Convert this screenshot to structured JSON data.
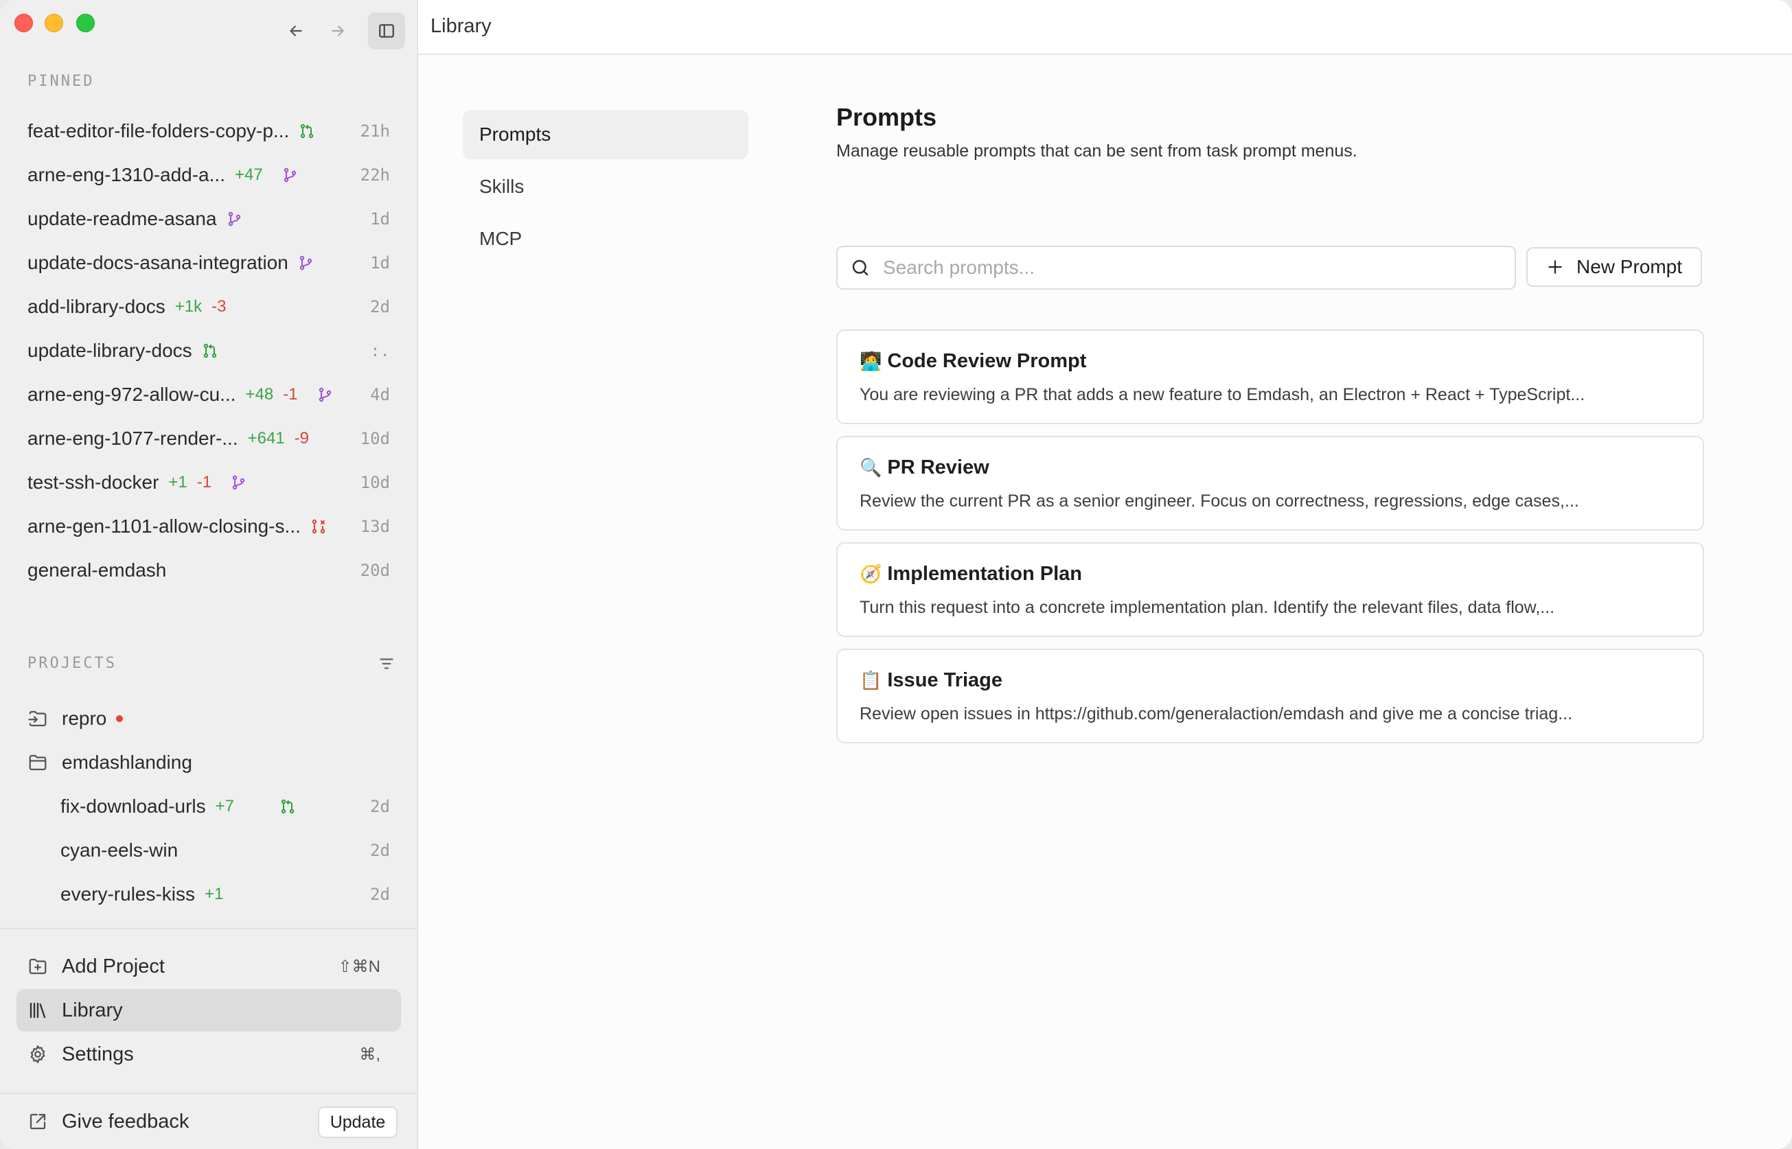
{
  "window": {
    "title": "Library"
  },
  "sidebar": {
    "pinned_label": "PINNED",
    "pinned": [
      {
        "name": "feat-editor-file-folders-copy-p...",
        "plus": "",
        "minus": "",
        "icon": "pr-open-icon",
        "age": "21h"
      },
      {
        "name": "arne-eng-1310-add-a...",
        "plus": "+47",
        "minus": "",
        "icon": "branch-icon",
        "age": "22h"
      },
      {
        "name": "update-readme-asana",
        "plus": "",
        "minus": "",
        "icon": "branch-icon",
        "age": "1d"
      },
      {
        "name": "update-docs-asana-integration",
        "plus": "",
        "minus": "",
        "icon": "branch-icon",
        "age": "1d"
      },
      {
        "name": "add-library-docs",
        "plus": "+1k",
        "minus": "-3",
        "icon": "",
        "age": "2d"
      },
      {
        "name": "update-library-docs",
        "plus": "",
        "minus": "",
        "icon": "pr-open-icon",
        "age": ":."
      },
      {
        "name": "arne-eng-972-allow-cu...",
        "plus": "+48",
        "minus": "-1",
        "icon": "branch-icon",
        "age": "4d"
      },
      {
        "name": "arne-eng-1077-render-...",
        "plus": "+641",
        "minus": "-9",
        "icon": "",
        "age": "10d"
      },
      {
        "name": "test-ssh-docker",
        "plus": "+1",
        "minus": "-1",
        "icon": "branch-icon",
        "age": "10d"
      },
      {
        "name": "arne-gen-1101-allow-closing-s...",
        "plus": "",
        "minus": "",
        "icon": "pr-closed-icon",
        "age": "13d"
      },
      {
        "name": "general-emdash",
        "plus": "",
        "minus": "",
        "icon": "",
        "age": "20d"
      }
    ],
    "projects_label": "PROJECTS",
    "projects": [
      {
        "name": "repro",
        "icon": "remote-project-icon"
      },
      {
        "name": "emdashlanding",
        "icon": "folder-icon"
      }
    ],
    "tasks": [
      {
        "name": "fix-download-urls",
        "plus": "+7",
        "icon": "pr-open-icon",
        "age": "2d"
      },
      {
        "name": "cyan-eels-win",
        "plus": "",
        "icon": "",
        "age": "2d"
      },
      {
        "name": "every-rules-kiss",
        "plus": "+1",
        "icon": "",
        "age": "2d"
      }
    ],
    "add_project": {
      "label": "Add Project",
      "shortcut": "⇧⌘N"
    },
    "library": {
      "label": "Library"
    },
    "settings": {
      "label": "Settings",
      "shortcut": "⌘,"
    },
    "feedback": {
      "label": "Give feedback"
    },
    "update_label": "Update"
  },
  "library_nav": [
    "Prompts",
    "Skills",
    "MCP"
  ],
  "main": {
    "heading": "Prompts",
    "description": "Manage reusable prompts that can be sent from task prompt menus.",
    "search_placeholder": "Search prompts...",
    "new_prompt_label": "New Prompt",
    "prompts": [
      {
        "emoji": "🧑‍💻",
        "title": "Code Review Prompt",
        "body": "You are reviewing a PR that adds a new feature to Emdash, an Electron + React + TypeScript..."
      },
      {
        "emoji": "🔍",
        "title": "PR Review",
        "body": "Review the current PR as a senior engineer. Focus on correctness, regressions, edge cases,..."
      },
      {
        "emoji": "🧭",
        "title": "Implementation Plan",
        "body": "Turn this request into a concrete implementation plan. Identify the relevant files, data flow,..."
      },
      {
        "emoji": "📋",
        "title": "Issue Triage",
        "body": "Review open issues in https://github.com/generalaction/emdash and give me a concise triag..."
      }
    ]
  },
  "colors": {
    "added": "#3da34a",
    "removed": "#d9443a",
    "branch": "#a14fd6",
    "pr_open": "#2f9e44"
  }
}
